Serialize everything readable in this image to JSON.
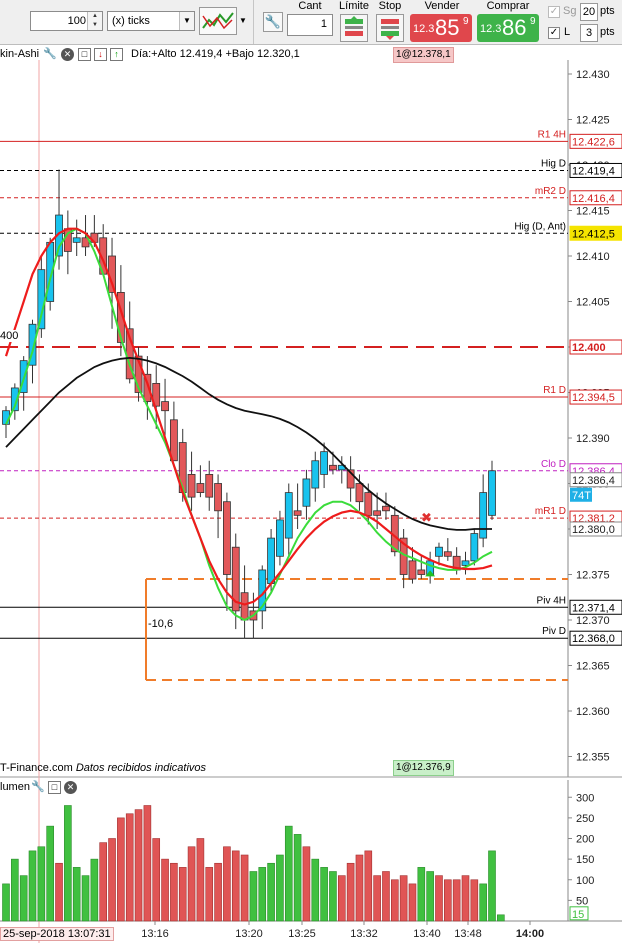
{
  "toolbar": {
    "quantity": "100",
    "unit": "(x) ticks",
    "headers": {
      "cant": "Cant",
      "limite": "Límite",
      "stop": "Stop",
      "vender": "Vender",
      "comprar": "Comprar"
    },
    "cant_value": "1",
    "sell": {
      "small": "12.3",
      "big": "85",
      "sup": "9"
    },
    "buy": {
      "small": "12.3",
      "big": "86",
      "sup": "9"
    },
    "sg_label": "Sg",
    "sg_value": "20",
    "pts": "pts",
    "l_label": "L",
    "l_value": "3",
    "colors": {
      "sell": "#e0474c",
      "buy": "#3eb34a"
    }
  },
  "main_pane": {
    "title": "kin-Ashi",
    "ohlc": "Día:+Alto 12.419,4 +Bajo 12.320,1",
    "top_tag": "1@12.378,1",
    "bottom_tag": "1@12.376,9",
    "footer": "T-Finance.com",
    "footer_italic": "Datos recibidos indicativos",
    "left_label": "400",
    "box_label": "-10,6",
    "axis_ticks": [
      "12.430",
      "12.425",
      "12.420",
      "12.415",
      "12.410",
      "12.405",
      "12.400",
      "12.395",
      "12.390",
      "12.385",
      "12.380",
      "12.375",
      "12.370",
      "12.365",
      "12.360",
      "12.355"
    ],
    "levels": [
      {
        "name": "R1 4H",
        "tag": "12.422,6",
        "price": 12.4226,
        "color": "#d42020",
        "style": "solid"
      },
      {
        "name": "Hig D",
        "tag": "12.419,4",
        "price": 12.4194,
        "color": "#000000",
        "style": "dash"
      },
      {
        "name": "mR2 D",
        "tag": "12.416,4",
        "price": 12.4164,
        "color": "#d42020",
        "style": "dash"
      },
      {
        "name": "Hig (D, Ant)",
        "tag": "12.412,5",
        "price": 12.4125,
        "color": "#000000",
        "style": "dash",
        "highlight": "#f5e400"
      },
      {
        "name": "",
        "tag": "12.400",
        "price": 12.4,
        "color": "#d42020",
        "style": "longdash"
      },
      {
        "name": "R1 D",
        "tag": "12.394,5",
        "price": 12.3945,
        "color": "#d42020",
        "style": "solid"
      },
      {
        "name": "Clo D",
        "tag": "12.386,4",
        "price": 12.3864,
        "color": "#c020c0",
        "style": "dash"
      },
      {
        "name": "mR1 D",
        "tag": "12.381,2",
        "price": 12.3812,
        "color": "#d42020",
        "style": "dash"
      },
      {
        "name": "Piv 4H",
        "tag": "12.371,4",
        "price": 12.3714,
        "color": "#000000",
        "style": "solid"
      },
      {
        "name": "Piv D",
        "tag": "12.368,0",
        "price": 12.368,
        "color": "#000000",
        "style": "solid"
      }
    ],
    "last_price_tag": "12.386,4",
    "last_price_label": "74T",
    "ma_tag": "12.380,0",
    "box_top_price": 12.3745,
    "box_bottom_price": 12.3634
  },
  "volume_pane": {
    "title": "lumen",
    "axis_ticks": [
      "300",
      "250",
      "200",
      "150",
      "100",
      "50"
    ],
    "last_value": "15"
  },
  "time_axis": {
    "cursor_label": "25-sep-2018 13:07:31",
    "ticks": [
      "13:16",
      "13:20",
      "13:25",
      "13:32",
      "13:40",
      "13:48",
      "14:00"
    ]
  },
  "chart_data": [
    {
      "type": "candlestick",
      "title": "",
      "ylim": [
        12.35,
        12.432
      ],
      "candles": [
        {
          "o": 12.3915,
          "h": 12.3935,
          "l": 12.39,
          "c": 12.393,
          "up": true
        },
        {
          "o": 12.393,
          "h": 12.396,
          "l": 12.392,
          "c": 12.3955,
          "up": true
        },
        {
          "o": 12.395,
          "h": 12.399,
          "l": 12.393,
          "c": 12.3985,
          "up": true
        },
        {
          "o": 12.398,
          "h": 12.403,
          "l": 12.396,
          "c": 12.4025,
          "up": true
        },
        {
          "o": 12.402,
          "h": 12.41,
          "l": 12.401,
          "c": 12.4085,
          "up": true
        },
        {
          "o": 12.405,
          "h": 12.412,
          "l": 12.404,
          "c": 12.4115,
          "up": true
        },
        {
          "o": 12.41,
          "h": 12.4195,
          "l": 12.4085,
          "c": 12.4145,
          "up": true
        },
        {
          "o": 12.413,
          "h": 12.415,
          "l": 12.408,
          "c": 12.4105,
          "up": false
        },
        {
          "o": 12.4115,
          "h": 12.414,
          "l": 12.41,
          "c": 12.412,
          "up": true
        },
        {
          "o": 12.412,
          "h": 12.4145,
          "l": 12.41,
          "c": 12.411,
          "up": false
        },
        {
          "o": 12.4125,
          "h": 12.4145,
          "l": 12.411,
          "c": 12.4115,
          "up": false
        },
        {
          "o": 12.412,
          "h": 12.4135,
          "l": 12.409,
          "c": 12.408,
          "up": false
        },
        {
          "o": 12.41,
          "h": 12.412,
          "l": 12.402,
          "c": 12.406,
          "up": false
        },
        {
          "o": 12.406,
          "h": 12.409,
          "l": 12.399,
          "c": 12.4005,
          "up": false
        },
        {
          "o": 12.402,
          "h": 12.405,
          "l": 12.396,
          "c": 12.3965,
          "up": false
        },
        {
          "o": 12.399,
          "h": 12.4,
          "l": 12.394,
          "c": 12.395,
          "up": false
        },
        {
          "o": 12.397,
          "h": 12.399,
          "l": 12.392,
          "c": 12.394,
          "up": false
        },
        {
          "o": 12.396,
          "h": 12.398,
          "l": 12.391,
          "c": 12.3935,
          "up": false
        },
        {
          "o": 12.394,
          "h": 12.3965,
          "l": 12.39,
          "c": 12.393,
          "up": false
        },
        {
          "o": 12.392,
          "h": 12.394,
          "l": 12.388,
          "c": 12.3875,
          "up": false
        },
        {
          "o": 12.3895,
          "h": 12.391,
          "l": 12.383,
          "c": 12.384,
          "up": false
        },
        {
          "o": 12.386,
          "h": 12.3885,
          "l": 12.382,
          "c": 12.3835,
          "up": false
        },
        {
          "o": 12.385,
          "h": 12.387,
          "l": 12.3835,
          "c": 12.384,
          "up": false
        },
        {
          "o": 12.386,
          "h": 12.3875,
          "l": 12.382,
          "c": 12.3835,
          "up": false
        },
        {
          "o": 12.385,
          "h": 12.386,
          "l": 12.379,
          "c": 12.382,
          "up": false
        },
        {
          "o": 12.383,
          "h": 12.384,
          "l": 12.371,
          "c": 12.375,
          "up": false
        },
        {
          "o": 12.378,
          "h": 12.3795,
          "l": 12.369,
          "c": 12.371,
          "up": false
        },
        {
          "o": 12.373,
          "h": 12.376,
          "l": 12.368,
          "c": 12.37,
          "up": false
        },
        {
          "o": 12.371,
          "h": 12.373,
          "l": 12.368,
          "c": 12.37,
          "up": false
        },
        {
          "o": 12.371,
          "h": 12.376,
          "l": 12.369,
          "c": 12.3755,
          "up": true
        },
        {
          "o": 12.374,
          "h": 12.38,
          "l": 12.373,
          "c": 12.379,
          "up": true
        },
        {
          "o": 12.377,
          "h": 12.382,
          "l": 12.376,
          "c": 12.381,
          "up": true
        },
        {
          "o": 12.379,
          "h": 12.385,
          "l": 12.377,
          "c": 12.384,
          "up": true
        },
        {
          "o": 12.382,
          "h": 12.385,
          "l": 12.38,
          "c": 12.3815,
          "up": false
        },
        {
          "o": 12.3825,
          "h": 12.3865,
          "l": 12.381,
          "c": 12.3855,
          "up": true
        },
        {
          "o": 12.3845,
          "h": 12.3885,
          "l": 12.383,
          "c": 12.3875,
          "up": true
        },
        {
          "o": 12.386,
          "h": 12.3895,
          "l": 12.3845,
          "c": 12.3885,
          "up": true
        },
        {
          "o": 12.387,
          "h": 12.3885,
          "l": 12.386,
          "c": 12.3865,
          "up": false
        },
        {
          "o": 12.3865,
          "h": 12.388,
          "l": 12.385,
          "c": 12.387,
          "up": true
        },
        {
          "o": 12.3865,
          "h": 12.388,
          "l": 12.383,
          "c": 12.3845,
          "up": false
        },
        {
          "o": 12.385,
          "h": 12.386,
          "l": 12.382,
          "c": 12.383,
          "up": false
        },
        {
          "o": 12.384,
          "h": 12.385,
          "l": 12.3805,
          "c": 12.3815,
          "up": false
        },
        {
          "o": 12.382,
          "h": 12.384,
          "l": 12.38,
          "c": 12.3815,
          "up": false
        },
        {
          "o": 12.3825,
          "h": 12.384,
          "l": 12.381,
          "c": 12.382,
          "up": false
        },
        {
          "o": 12.3815,
          "h": 12.3825,
          "l": 12.377,
          "c": 12.3775,
          "up": false
        },
        {
          "o": 12.379,
          "h": 12.38,
          "l": 12.3735,
          "c": 12.375,
          "up": false
        },
        {
          "o": 12.3765,
          "h": 12.378,
          "l": 12.374,
          "c": 12.3745,
          "up": false
        },
        {
          "o": 12.3755,
          "h": 12.377,
          "l": 12.3745,
          "c": 12.375,
          "up": false
        },
        {
          "o": 12.375,
          "h": 12.3775,
          "l": 12.374,
          "c": 12.3765,
          "up": true
        },
        {
          "o": 12.377,
          "h": 12.3785,
          "l": 12.376,
          "c": 12.378,
          "up": true
        },
        {
          "o": 12.3775,
          "h": 12.379,
          "l": 12.3765,
          "c": 12.377,
          "up": false
        },
        {
          "o": 12.377,
          "h": 12.378,
          "l": 12.375,
          "c": 12.3755,
          "up": false
        },
        {
          "o": 12.376,
          "h": 12.3775,
          "l": 12.375,
          "c": 12.3765,
          "up": true
        },
        {
          "o": 12.3765,
          "h": 12.38,
          "l": 12.376,
          "c": 12.3795,
          "up": true
        },
        {
          "o": 12.379,
          "h": 12.386,
          "l": 12.378,
          "c": 12.384,
          "up": true
        },
        {
          "o": 12.3815,
          "h": 12.3875,
          "l": 12.381,
          "c": 12.3864,
          "up": true
        }
      ],
      "series": [
        {
          "style": "green",
          "values": [
            12.3915,
            12.3935,
            12.3965,
            12.3995,
            12.4035,
            12.4075,
            12.411,
            12.4125,
            12.413,
            12.4125,
            12.4105,
            12.408,
            12.4045,
            12.401,
            12.398,
            12.3955,
            12.3935,
            12.3915,
            12.3895,
            12.387,
            12.3845,
            12.3815,
            12.379,
            12.376,
            12.3735,
            12.3715,
            12.3705,
            12.37,
            12.3705,
            12.3715,
            12.373,
            12.375,
            12.377,
            12.379,
            12.3805,
            12.3818,
            12.3826,
            12.383,
            12.383,
            12.3826,
            12.3818,
            12.3808,
            12.3796,
            12.3786,
            12.3778,
            12.3772,
            12.3768,
            12.3764,
            12.376,
            12.3757,
            12.3755,
            12.3755,
            12.3758,
            12.3763,
            12.377,
            12.3775
          ]
        },
        {
          "style": "red",
          "values": [
            12.399,
            12.402,
            12.405,
            12.408,
            12.41,
            12.4115,
            12.4125,
            12.413,
            12.413,
            12.4125,
            12.4115,
            12.4095,
            12.407,
            12.404,
            12.401,
            12.3985,
            12.396,
            12.393,
            12.39,
            12.387,
            12.384,
            12.3815,
            12.379,
            12.3765,
            12.3745,
            12.373,
            12.372,
            12.3717,
            12.372,
            12.3728,
            12.374,
            12.3752,
            12.3765,
            12.3778,
            12.379,
            12.38,
            12.3808,
            12.3814,
            12.3818,
            12.382,
            12.3818,
            12.3814,
            12.3808,
            12.38,
            12.3792,
            12.3784,
            12.3777,
            12.3771,
            12.3766,
            12.3762,
            12.3759,
            12.3757,
            12.3756,
            12.3756,
            12.3757,
            12.376
          ]
        },
        {
          "style": "black",
          "values": [
            12.389,
            12.39,
            12.391,
            12.392,
            12.393,
            12.394,
            12.395,
            12.3958,
            12.3966,
            12.3972,
            12.3978,
            12.3982,
            12.3985,
            12.3987,
            12.3988,
            12.3987,
            12.3985,
            12.3982,
            12.3978,
            12.3973,
            12.3968,
            12.3962,
            12.3955,
            12.3948,
            12.3942,
            12.3937,
            12.3933,
            12.393,
            12.3928,
            12.3926,
            12.3924,
            12.3921,
            12.3917,
            12.3912,
            12.3906,
            12.3899,
            12.3891,
            12.3882,
            12.3872,
            12.3862,
            12.3852,
            12.3843,
            12.3835,
            12.3828,
            12.3822,
            12.3816,
            12.3811,
            12.3807,
            12.3804,
            12.3802,
            12.38,
            12.3799,
            12.3799,
            12.38,
            12.38,
            12.38
          ]
        }
      ]
    },
    {
      "type": "bar",
      "title": "",
      "ylim": [
        0,
        320
      ],
      "values": [
        90,
        150,
        110,
        170,
        180,
        230,
        140,
        280,
        130,
        110,
        150,
        190,
        200,
        250,
        260,
        270,
        280,
        200,
        150,
        140,
        130,
        180,
        200,
        130,
        140,
        180,
        170,
        160,
        120,
        130,
        140,
        160,
        230,
        210,
        180,
        150,
        130,
        120,
        110,
        140,
        160,
        170,
        110,
        120,
        100,
        110,
        90,
        130,
        120,
        110,
        100,
        100,
        110,
        100,
        90,
        170,
        15
      ],
      "colors": [
        "up",
        "up",
        "up",
        "up",
        "up",
        "up",
        "down",
        "up",
        "up",
        "up",
        "up",
        "down",
        "down",
        "down",
        "down",
        "down",
        "down",
        "down",
        "down",
        "down",
        "down",
        "down",
        "down",
        "down",
        "down",
        "down",
        "down",
        "down",
        "up",
        "up",
        "up",
        "up",
        "up",
        "up",
        "down",
        "up",
        "up",
        "up",
        "down",
        "down",
        "down",
        "down",
        "down",
        "down",
        "down",
        "down",
        "down",
        "up",
        "up",
        "down",
        "down",
        "down",
        "down",
        "down",
        "up",
        "up",
        "up"
      ]
    }
  ]
}
